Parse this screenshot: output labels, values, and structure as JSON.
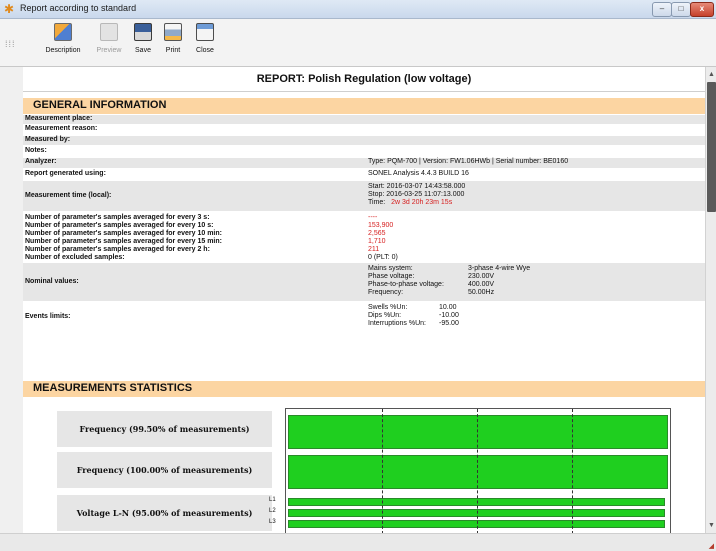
{
  "window": {
    "title": "Report according to standard",
    "controls": {
      "minimize": "–",
      "maximize": "□",
      "close": "x"
    }
  },
  "toolbar": {
    "grip": "⁞⁞⁞",
    "buttons": [
      {
        "label": "Description",
        "enabled": true,
        "icon": "description-icon"
      },
      {
        "label": "Preview",
        "enabled": false,
        "icon": "preview-icon"
      },
      {
        "label": "Save",
        "enabled": true,
        "icon": "save-icon"
      },
      {
        "label": "Print",
        "enabled": true,
        "icon": "print-icon"
      },
      {
        "label": "Close",
        "enabled": true,
        "icon": "close-icon"
      }
    ]
  },
  "report": {
    "title": "REPORT: Polish Regulation (low voltage)",
    "general": {
      "header": "GENERAL INFORMATION",
      "measurement_place": "Measurement place:",
      "measurement_reason": "Measurement reason:",
      "measured_by": "Measured by:",
      "notes": "Notes:",
      "analyzer_label": "Analyzer:",
      "analyzer_value": "Type: PQM-700 | Version: FW1.06HWb | Serial number: BE0160",
      "generated_label": "Report generated using:",
      "generated_value": "SONEL Analysis 4.4.3 BUILD 16",
      "time_label": "Measurement time (local):",
      "time_start": "Start:   2016-03-07 14:43:58.000",
      "time_stop": "Stop:   2016-03-25 11:07:13.000",
      "time_total_label": "Time:",
      "time_total": "2w 3d 20h 23m 15s",
      "samples": [
        {
          "label": "Number of parameter's samples averaged for every 3 s:",
          "value": "----",
          "highlight": true
        },
        {
          "label": "Number of parameter's samples averaged for every 10 s:",
          "value": "153,900",
          "highlight": true
        },
        {
          "label": "Number of parameter's samples averaged for every 10 min:",
          "value": "2,565",
          "highlight": true
        },
        {
          "label": "Number of parameter's samples averaged for every 15 min:",
          "value": "1,710",
          "highlight": true
        },
        {
          "label": "Number of parameter's samples averaged for every 2 h:",
          "value": "211",
          "highlight": true
        },
        {
          "label": "Number of excluded samples:",
          "value": "0 (PLT: 0)",
          "highlight": false
        }
      ],
      "nominal_label": "Nominal values:",
      "nominal": [
        {
          "k": "Mains system:",
          "v": "3-phase 4-wire Wye"
        },
        {
          "k": "Phase voltage:",
          "v": "230.00V"
        },
        {
          "k": "Phase-to-phase voltage:",
          "v": "400.00V"
        },
        {
          "k": "Frequency:",
          "v": "50.00Hz"
        }
      ],
      "events_label": "Events limits:",
      "events": [
        {
          "k": "Swells %Un:",
          "v": "10.00"
        },
        {
          "k": "Dips %Un:",
          "v": "-10.00"
        },
        {
          "k": "Interruptions %Un:",
          "v": "-95.00"
        }
      ]
    },
    "stats": {
      "header": "MEASUREMENTS STATISTICS",
      "rows": [
        {
          "label": "Frequency (99.50% of measurements)"
        },
        {
          "label": "Frequency (100.00% of measurements)"
        },
        {
          "label": "Voltage L-N (95.00% of measurements)",
          "phases": [
            "L1",
            "L2",
            "L3"
          ]
        }
      ]
    }
  },
  "colors": {
    "section_header": "#fcd5a2",
    "bar_fill": "#1fcf1f",
    "highlight_text": "#d61f1f"
  }
}
